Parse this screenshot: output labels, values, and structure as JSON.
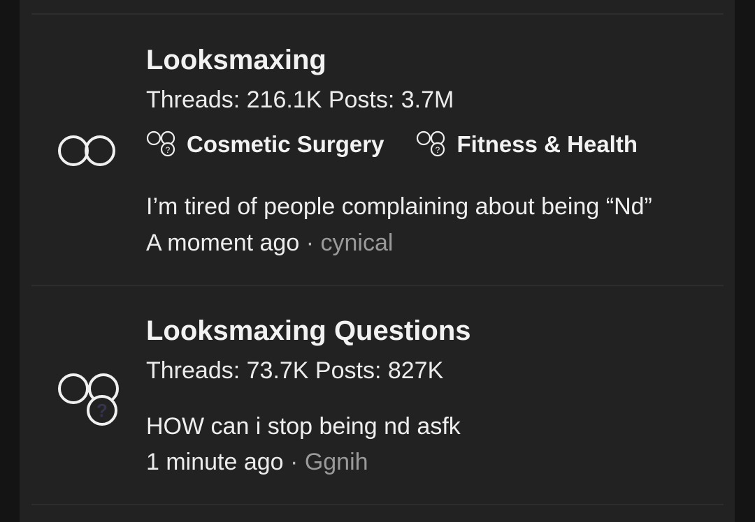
{
  "nodes": [
    {
      "title": "Looksmaxing",
      "stats": "Threads: 216.1K Posts: 3.7M",
      "icon": "linked-rings-icon",
      "subforums": [
        {
          "label": "Cosmetic Surgery",
          "icon": "forum-question-icon"
        },
        {
          "label": "Fitness & Health",
          "icon": "forum-question-icon"
        }
      ],
      "latest": {
        "title": "I’m tired of people complaining about being “Nd”",
        "time": "A moment ago",
        "separator": "·",
        "user": "cynical"
      }
    },
    {
      "title": "Looksmaxing Questions",
      "stats": "Threads: 73.7K Posts: 827K",
      "icon": "rings-question-icon",
      "latest": {
        "title": "HOW can i stop being nd asfk",
        "time": "1 minute ago",
        "separator": "·",
        "user": "Ggnih"
      }
    }
  ]
}
